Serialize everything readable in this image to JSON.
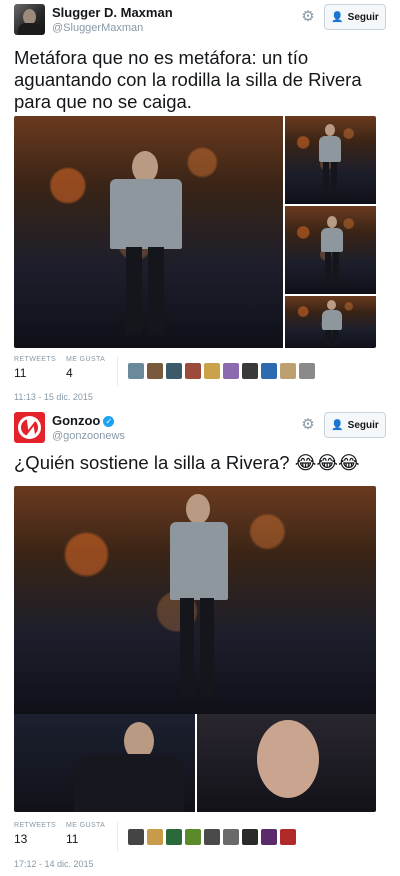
{
  "tweets": [
    {
      "name": "Slugger D. Maxman",
      "handle": "@SluggerMaxman",
      "verified": false,
      "follow_label": "Seguir",
      "text": "Metáfora que no es metáfora: un tío aguantando con la rodilla la silla de Rivera para que no se caiga.",
      "retweets_label": "RETWEETS",
      "retweets": "11",
      "likes_label": "ME GUSTA",
      "likes": "4",
      "timestamp": "11:13 - 15 dic. 2015",
      "liker_colors": [
        "#6a8a9c",
        "#7a5a3c",
        "#3c5a6a",
        "#9c4a3c",
        "#c9a24a",
        "#8c6ab0",
        "#3a3a3a",
        "#2d6bb0",
        "#bca070",
        "#8a8a8a"
      ]
    },
    {
      "name": "Gonzoo",
      "handle": "@gonzoonews",
      "verified": true,
      "follow_label": "Seguir",
      "text": "¿Quién sostiene la silla a Rivera? 😂😂😂",
      "retweets_label": "RETWEETS",
      "retweets": "13",
      "likes_label": "ME GUSTA",
      "likes": "11",
      "timestamp": "17:12 - 14 dic. 2015",
      "liker_colors": [
        "#444444",
        "#c89a4a",
        "#2a6a3a",
        "#5a8a2a",
        "#4a4a4a",
        "#6a6a6a",
        "#2a2a2a",
        "#5a2a6a",
        "#b02a2a"
      ]
    }
  ],
  "icons": {
    "gear": "gear-icon",
    "follow": "person-add-icon",
    "verified": "verified-badge-icon"
  },
  "colors": {
    "accent": "#1da1f2",
    "muted": "#8899a6",
    "text": "#14171a"
  }
}
